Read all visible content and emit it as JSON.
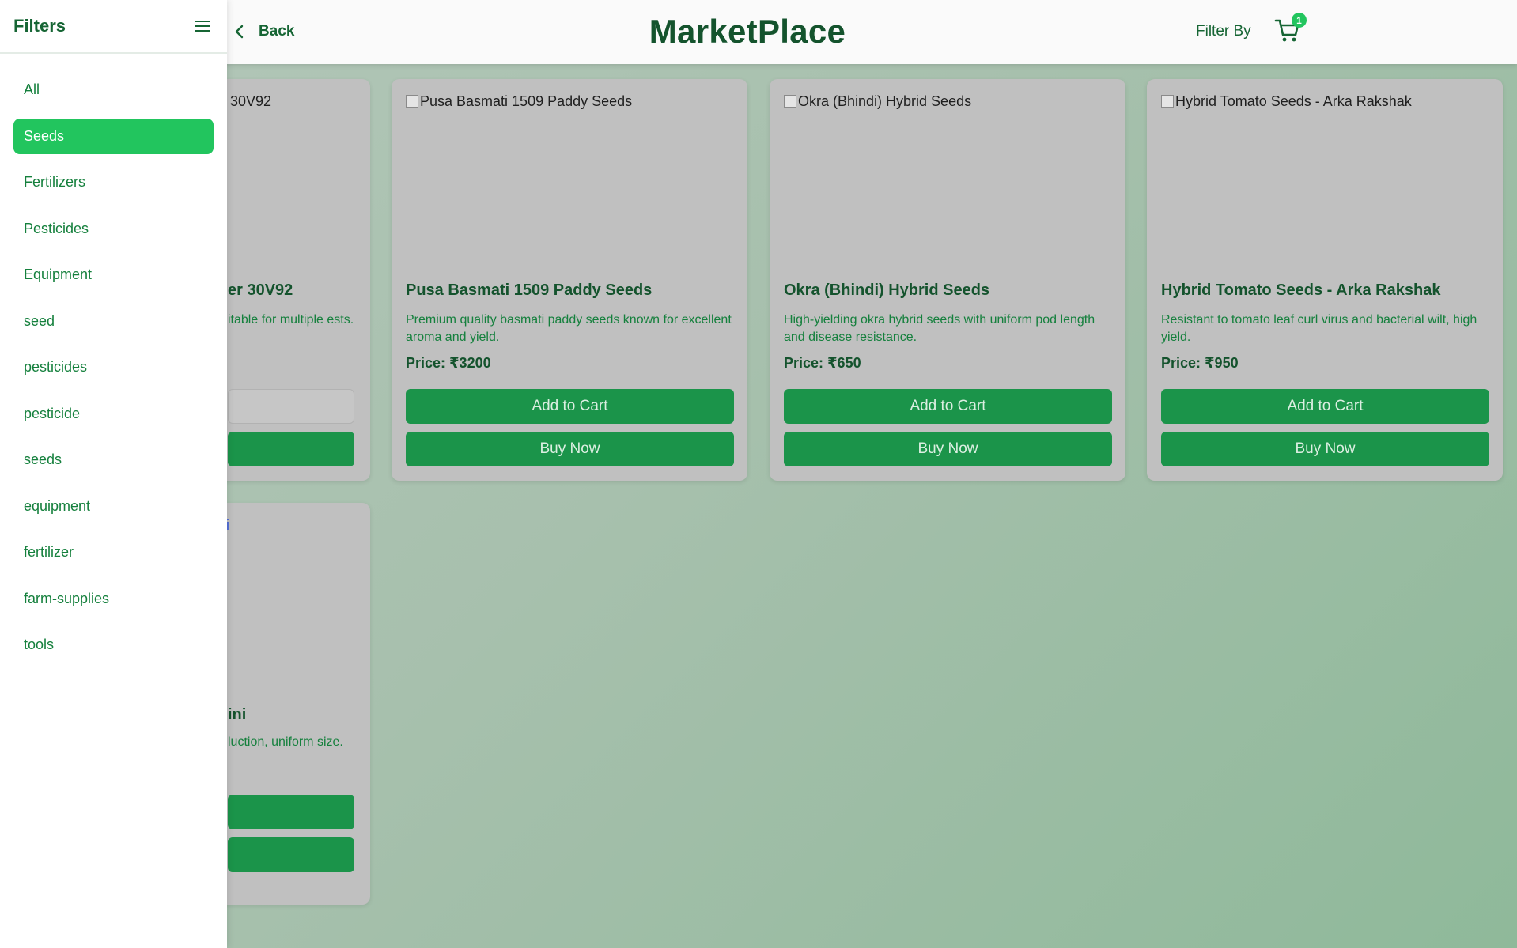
{
  "sidebar": {
    "title": "Filters",
    "menu_icon": "hamburger-menu-icon",
    "items": [
      {
        "label": "All",
        "active": false
      },
      {
        "label": "Seeds",
        "active": true
      },
      {
        "label": "Fertilizers",
        "active": false
      },
      {
        "label": "Pesticides",
        "active": false
      },
      {
        "label": "Equipment",
        "active": false
      },
      {
        "label": "seed",
        "active": false
      },
      {
        "label": "pesticides",
        "active": false
      },
      {
        "label": "pesticide",
        "active": false
      },
      {
        "label": "seeds",
        "active": false
      },
      {
        "label": "equipment",
        "active": false
      },
      {
        "label": "fertilizer",
        "active": false
      },
      {
        "label": "farm-supplies",
        "active": false
      },
      {
        "label": "tools",
        "active": false
      }
    ],
    "active_color": "#22c55e"
  },
  "header": {
    "back_label": "Back",
    "back_icon": "chevron-left-icon",
    "brand": "MarketPlace",
    "filter_by_label": "Filter By",
    "cart_icon": "shopping-cart-icon",
    "cart_count": "1"
  },
  "products": [
    {
      "alt_visible": "30V92",
      "title_visible": "er 30V92",
      "desc_visible": "itable for multiple ests."
    },
    {
      "alt": "Pusa Basmati 1509 Paddy Seeds",
      "title": "Pusa Basmati 1509 Paddy Seeds",
      "desc": "Premium quality basmati paddy seeds known for excellent aroma and yield.",
      "price": "Price: ₹3200",
      "add_label": "Add to Cart",
      "buy_label": "Buy Now"
    },
    {
      "alt": "Okra (Bhindi) Hybrid Seeds",
      "title": "Okra (Bhindi) Hybrid Seeds",
      "desc": "High-yielding okra hybrid seeds with uniform pod length and disease resistance.",
      "price": "Price: ₹650",
      "add_label": "Add to Cart",
      "buy_label": "Buy Now"
    },
    {
      "alt": "Hybrid Tomato Seeds - Arka Rakshak",
      "title": "Hybrid Tomato Seeds - Arka Rakshak",
      "desc": "Resistant to tomato leaf curl virus and bacterial wilt, high yield.",
      "price": "Price: ₹950",
      "add_label": "Add to Cart",
      "buy_label": "Buy Now"
    },
    {
      "title_visible": "ini",
      "desc_visible": "luction, uniform size."
    }
  ],
  "colors": {
    "brand_dark": "#14532d",
    "primary_text": "#166534",
    "button_green": "#1b944a",
    "card_bg": "#c0c0c0"
  }
}
